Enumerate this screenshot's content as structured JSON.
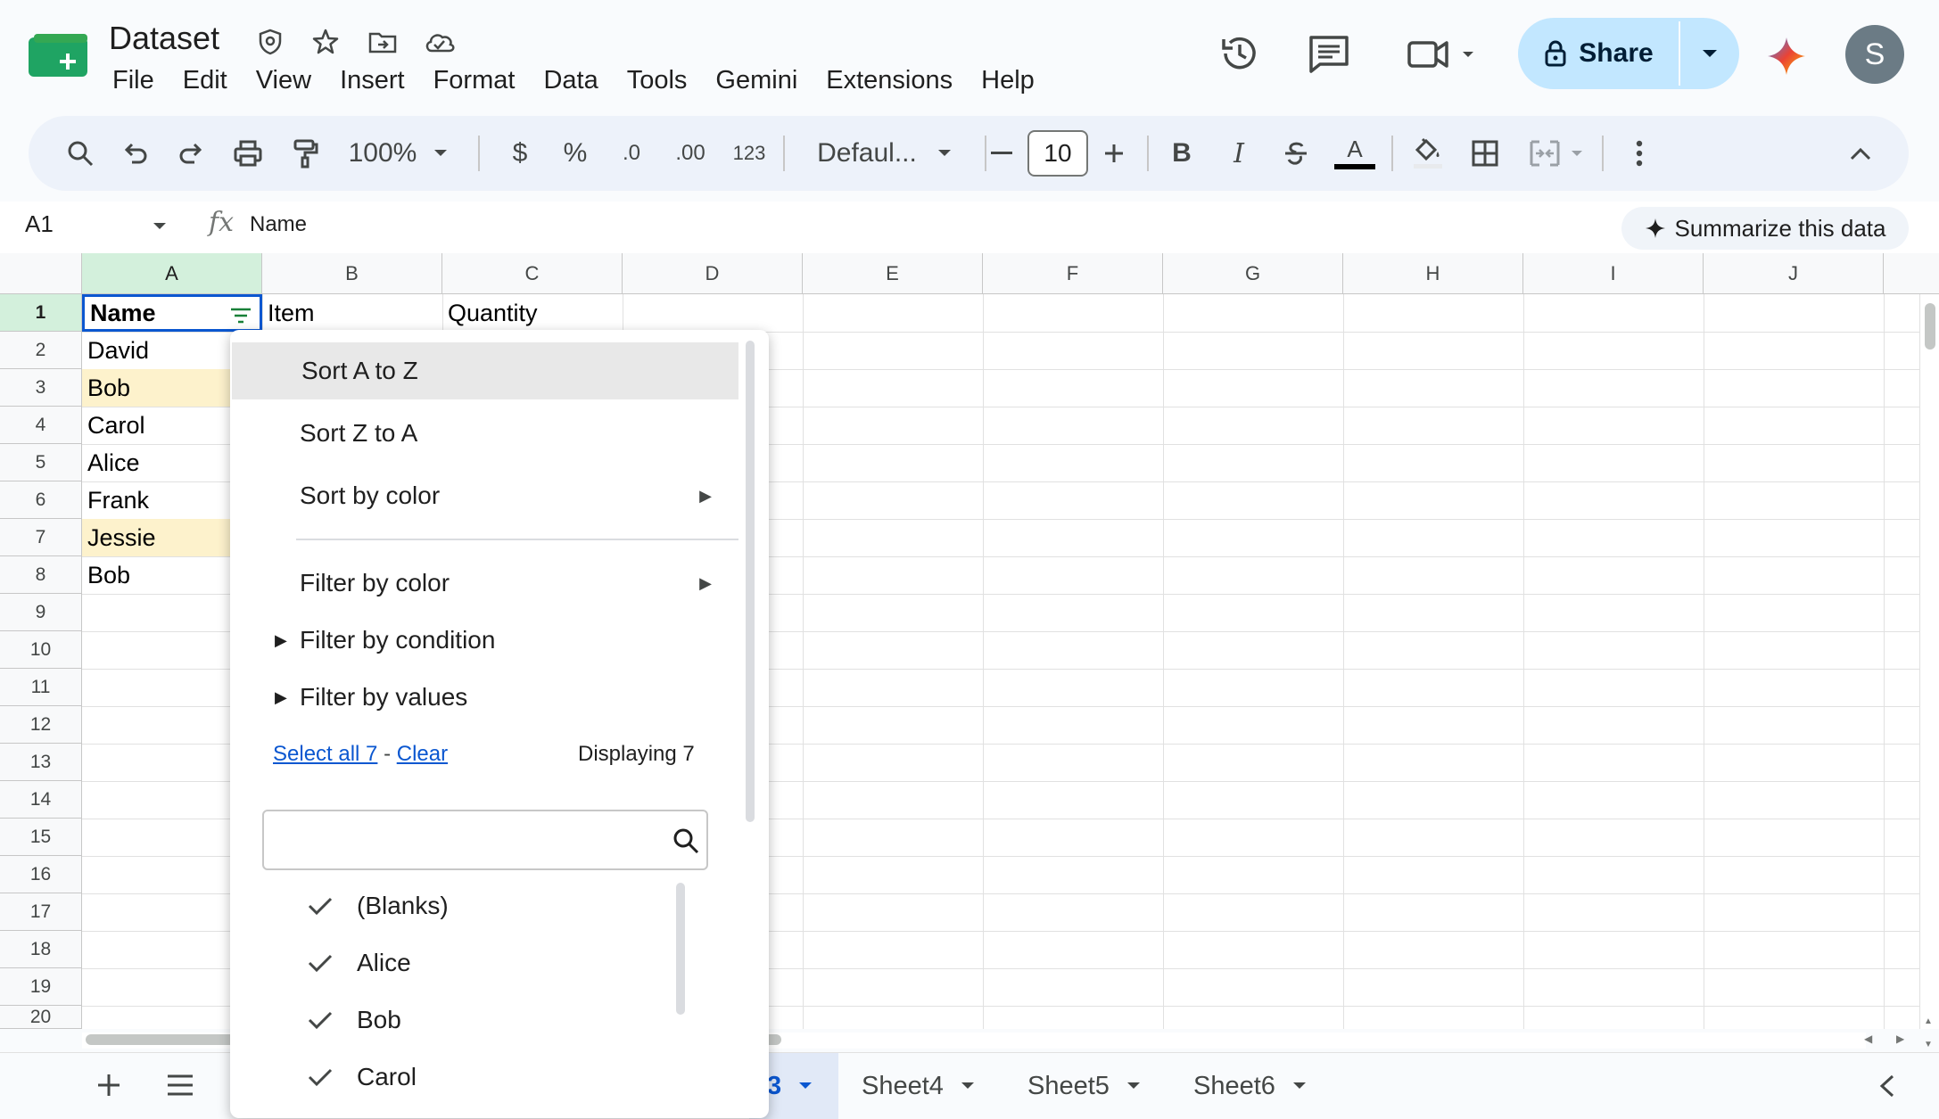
{
  "app": {
    "doc_title": "Dataset",
    "menus": [
      "File",
      "Edit",
      "View",
      "Insert",
      "Format",
      "Data",
      "Tools",
      "Gemini",
      "Extensions",
      "Help"
    ],
    "share_label": "Share",
    "avatar_letter": "S"
  },
  "toolbar": {
    "zoom": "100%",
    "currency": "$",
    "percent": "%",
    "dec_decrease": ".0",
    "dec_increase": ".00",
    "number_format": "123",
    "font": "Defaul...",
    "font_size": "10",
    "bold": "B",
    "italic": "I",
    "text_color_glyph": "A"
  },
  "formula_bar": {
    "cell_ref": "A1",
    "fx": "fx",
    "value": "Name",
    "summarize_label": "Summarize this data"
  },
  "grid": {
    "columns": [
      "A",
      "B",
      "C",
      "D",
      "E",
      "F",
      "G",
      "H",
      "I",
      "J"
    ],
    "rows": [
      "1",
      "2",
      "3",
      "4",
      "5",
      "6",
      "7",
      "8",
      "9",
      "10",
      "11",
      "12",
      "13",
      "14",
      "15",
      "16",
      "17",
      "18",
      "19",
      "20"
    ],
    "header": {
      "a": "Name",
      "b": "Item",
      "c": "Quantity"
    },
    "names": [
      "David",
      "Bob",
      "Carol",
      "Alice",
      "Frank",
      "Jessie",
      "Bob"
    ],
    "highlight_color": "#fdf2cc"
  },
  "filter_menu": {
    "sort_az": "Sort A to Z",
    "sort_za": "Sort Z to A",
    "sort_by_color": "Sort by color",
    "filter_by_color": "Filter by color",
    "filter_by_condition": "Filter by condition",
    "filter_by_values": "Filter by values",
    "select_all": "Select all 7",
    "separator": " - ",
    "clear": "Clear",
    "displaying": "Displaying 7",
    "values": [
      "(Blanks)",
      "Alice",
      "Bob",
      "Carol"
    ]
  },
  "sheets": {
    "partial_tab": "3",
    "tabs": [
      "Sheet4",
      "Sheet5",
      "Sheet6"
    ]
  },
  "colors": {
    "accent": "#0b57d0",
    "share_bg": "#c2e7ff",
    "selected_header": "#d3f0dc"
  }
}
